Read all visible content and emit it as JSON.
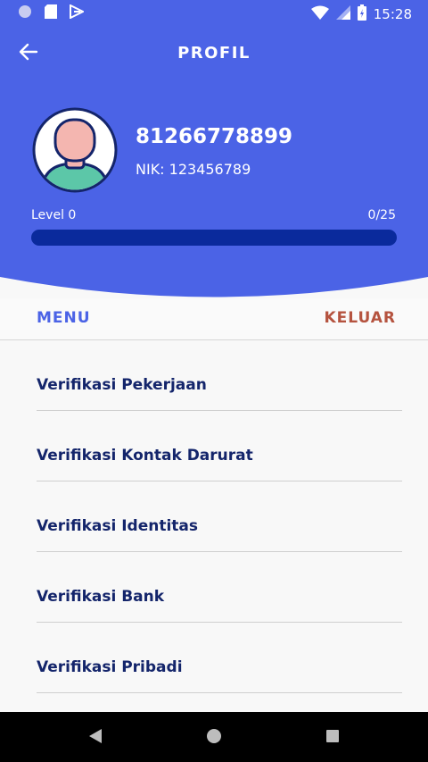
{
  "status_bar": {
    "time": "15:28"
  },
  "header": {
    "title": "PROFIL"
  },
  "profile": {
    "phone": "81266778899",
    "nik": "NIK: 123456789",
    "level_label": "Level 0",
    "level_count": "0/25",
    "progress": 0
  },
  "tabs": {
    "menu": "MENU",
    "logout": "KELUAR"
  },
  "menu_items": [
    {
      "label": "Verifikasi Pekerjaan"
    },
    {
      "label": "Verifikasi Kontak Darurat"
    },
    {
      "label": "Verifikasi Identitas"
    },
    {
      "label": "Verifikasi Bank"
    },
    {
      "label": "Verifikasi Pribadi"
    }
  ],
  "colors": {
    "primary": "#4b63e6",
    "progress_track": "#0a2a9c",
    "logout": "#b5533f",
    "list_text": "#14256b"
  }
}
